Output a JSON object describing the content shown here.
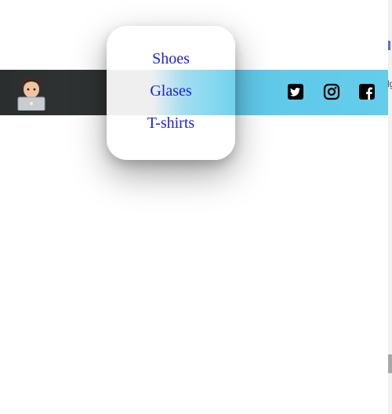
{
  "navbar": {
    "avatar_icon": "avatar-laptop-icon",
    "social": [
      {
        "name": "twitter-icon"
      },
      {
        "name": "instagram-icon"
      },
      {
        "name": "facebook-icon"
      }
    ]
  },
  "menu": {
    "items": [
      "Shoes",
      "Glases",
      "T-shirts"
    ]
  },
  "edge": {
    "fragment": "lg"
  },
  "colors": {
    "navbar_dark": "#2b2e2e",
    "navbar_accent": "#63cdeb",
    "link": "#1d1fd0"
  }
}
